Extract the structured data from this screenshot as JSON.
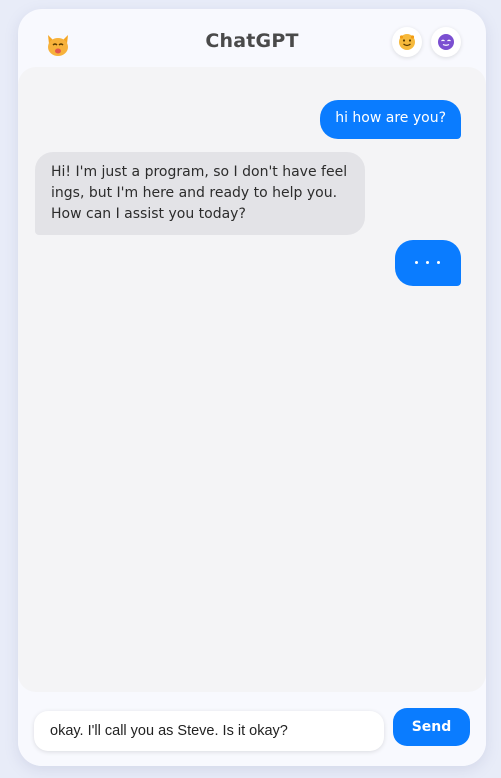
{
  "header": {
    "title": "ChatGPT",
    "logo_icon": "cat-face-icon",
    "buttons": [
      {
        "icon": "smiling-face-icon"
      },
      {
        "icon": "purple-face-icon"
      }
    ]
  },
  "messages": [
    {
      "role": "user",
      "text": "hi how are you?"
    },
    {
      "role": "assistant",
      "text": "Hi! I'm just a program, so I don't have feelings, but I'm here and ready to help you. How can I assist you today?"
    },
    {
      "role": "user",
      "text": "",
      "typing": true
    }
  ],
  "composer": {
    "value": "okay. I'll call you as Steve. Is it okay?",
    "send_label": "Send"
  },
  "colors": {
    "accent": "#0a7cff",
    "bubble_bot": "#e3e3e7",
    "chat_bg": "#f4f4f6"
  }
}
